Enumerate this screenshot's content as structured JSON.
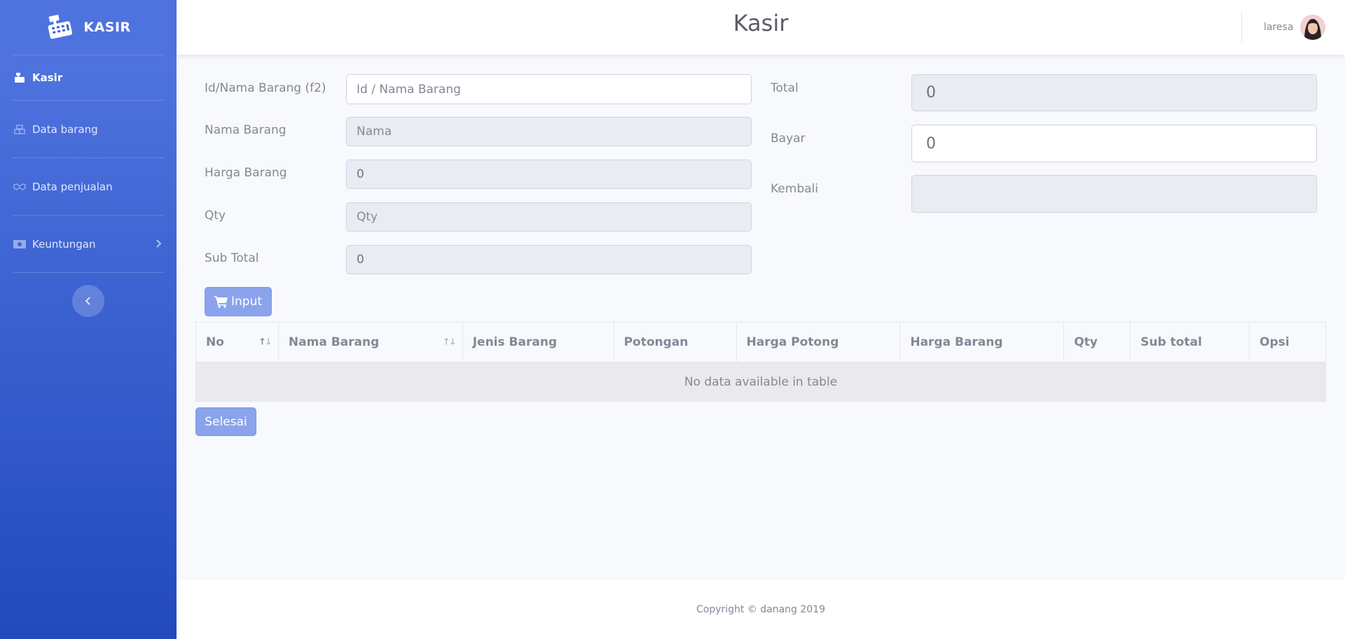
{
  "brand": {
    "name": "KASIR",
    "icon": "cash-register-icon"
  },
  "sidebar": {
    "items": [
      {
        "label": "Kasir",
        "icon": "cash-register-icon"
      },
      {
        "label": "Data barang",
        "icon": "boxes-icon"
      },
      {
        "label": "Data penjualan",
        "icon": "handshake-icon"
      },
      {
        "label": "Keuntungan",
        "icon": "money-bill-icon"
      }
    ],
    "toggle_icon": "chevron-left-icon"
  },
  "topbar": {
    "title": "Kasir",
    "user_name": "laresa"
  },
  "form": {
    "id_label": "Id/Nama Barang (f2)",
    "id_placeholder": "Id / Nama Barang",
    "nama_label": "Nama Barang",
    "nama_placeholder": "Nama",
    "harga_label": "Harga Barang",
    "harga_value": "0",
    "qty_label": "Qty",
    "qty_placeholder": "Qty",
    "subtotal_label": "Sub Total",
    "subtotal_value": "0",
    "total_label": "Total",
    "total_value": "0",
    "bayar_label": "Bayar",
    "bayar_value": "0",
    "kembali_label": "Kembali",
    "kembali_value": "",
    "input_button": "Input"
  },
  "table": {
    "columns": [
      "No",
      "Nama Barang",
      "Jenis Barang",
      "Potongan",
      "Harga Potong",
      "Harga Barang",
      "Qty",
      "Sub total",
      "Opsi"
    ],
    "empty_text": "No data available in table"
  },
  "selesai_button": "Selesai",
  "footer": {
    "text": "Copyright © danang 2019"
  }
}
